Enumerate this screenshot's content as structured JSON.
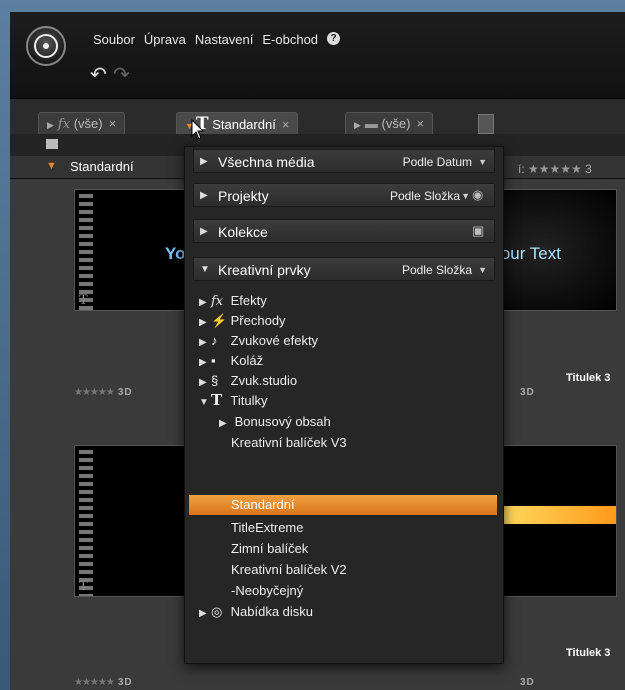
{
  "menu": {
    "items": [
      "Soubor",
      "Úprava",
      "Nastavení",
      "E-obchod"
    ]
  },
  "tabs": [
    {
      "prefix": "fx",
      "label": "(vše)",
      "close": "×"
    },
    {
      "prefix": "T",
      "label": "Standardní",
      "close": "×"
    },
    {
      "prefix": "",
      "label": "(vše)",
      "close": "×"
    }
  ],
  "category": {
    "label": "Standardní"
  },
  "rating": {
    "label": "í:",
    "stars": "★★★★★",
    "extra": "3"
  },
  "thumbs": {
    "title_top": "Titulek 3",
    "title_bottom": "Titulek 3",
    "your_text_left": "Yo",
    "your_text_right": "Your Text",
    "badge_3d": "3D",
    "stars": "★★★★★"
  },
  "dropdown": {
    "sections": [
      {
        "label": "Všechna média",
        "sort": "Podle Datum"
      },
      {
        "label": "Projekty",
        "sort": "Podle Složka"
      },
      {
        "label": "Kolekce",
        "sort": ""
      },
      {
        "label": "Kreativní prvky",
        "sort": "Podle Složka"
      }
    ],
    "items": [
      {
        "label": "Efekty",
        "icon": "fx"
      },
      {
        "label": "Přechody",
        "icon": "⚡"
      },
      {
        "label": "Zvukové efekty",
        "icon": "♪"
      },
      {
        "label": "Koláž",
        "icon": "▪"
      },
      {
        "label": "Zvuk.studio",
        "icon": "𝄞"
      },
      {
        "label": "Titulky",
        "icon": "T"
      }
    ],
    "subitems": [
      "Bonusový obsah",
      "Kreativní balíček V3",
      "Standardní",
      "TitleExtreme",
      "Zimní balíček",
      "Kreativní balíček V2",
      "-Neobyčejný"
    ],
    "last_item": {
      "label": "Nabídka disku",
      "icon": "◎"
    }
  }
}
